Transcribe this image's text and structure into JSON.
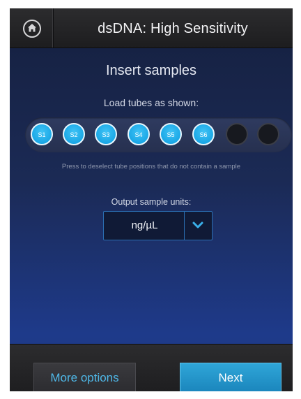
{
  "header": {
    "title": "dsDNA: High Sensitivity",
    "home_icon": "home-icon"
  },
  "main": {
    "heading": "Insert samples",
    "load_label": "Load tubes as shown:",
    "tubes": [
      {
        "label": "S1",
        "selected": true
      },
      {
        "label": "S2",
        "selected": true
      },
      {
        "label": "S3",
        "selected": true
      },
      {
        "label": "S4",
        "selected": true
      },
      {
        "label": "S5",
        "selected": true
      },
      {
        "label": "S6",
        "selected": true
      },
      {
        "label": "",
        "selected": false
      },
      {
        "label": "",
        "selected": false
      }
    ],
    "hint": "Press to deselect tube positions that do not contain a sample",
    "units_label": "Output sample units:",
    "units_value": "ng/µL",
    "units_dropdown_icon": "chevron-down-icon"
  },
  "footer": {
    "more_options_label": "More options",
    "next_label": "Next"
  },
  "colors": {
    "accent": "#1aa7e6",
    "header_bg": "#2c2c2e",
    "body_bg": "#1b2a55",
    "link_text": "#4fb8e8"
  }
}
